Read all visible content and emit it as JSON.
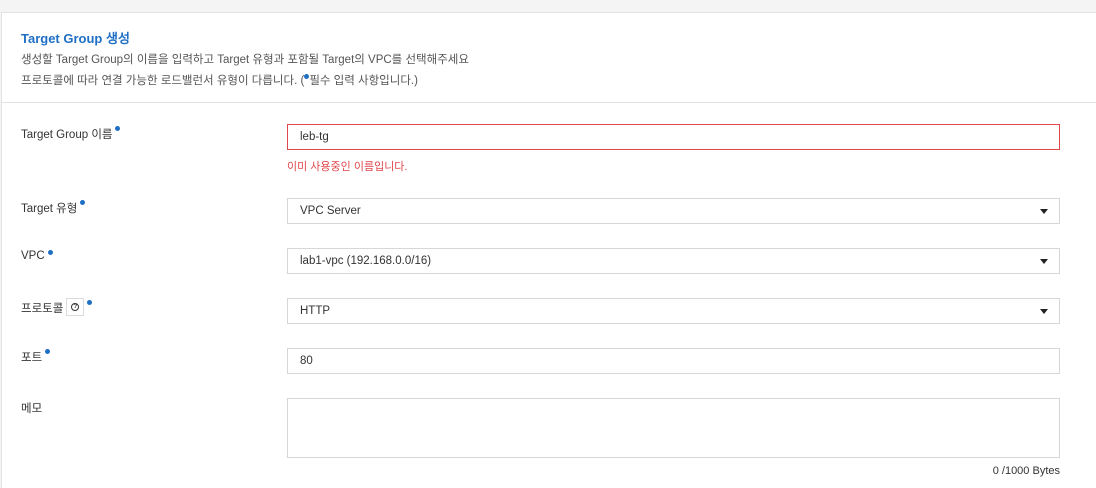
{
  "header": {
    "title": "Target Group 생성",
    "desc_line1": "생성할 Target Group의 이름을 입력하고 Target 유형과 포함될 Target의 VPC를 선택해주세요",
    "desc_line2_prefix": "프로토콜에 따라 연결 가능한 로드밸런서 유형이 다릅니다. (",
    "desc_line2_suffix": "필수 입력 사항입니다.)"
  },
  "form": {
    "name": {
      "label": "Target Group 이름",
      "value": "leb-tg",
      "error": "이미 사용중인 이름입니다."
    },
    "target_type": {
      "label": "Target 유형",
      "selected": "VPC Server"
    },
    "vpc": {
      "label": "VPC",
      "selected": "lab1-vpc (192.168.0.0/16)"
    },
    "protocol": {
      "label": "프로토콜",
      "selected": "HTTP",
      "help_glyph": "?"
    },
    "port": {
      "label": "포트",
      "value": "80"
    },
    "memo": {
      "label": "메모",
      "value": "",
      "counter": "0 /1000 Bytes"
    }
  },
  "colors": {
    "accent": "#1f6fc5",
    "error": "#e0474c"
  }
}
